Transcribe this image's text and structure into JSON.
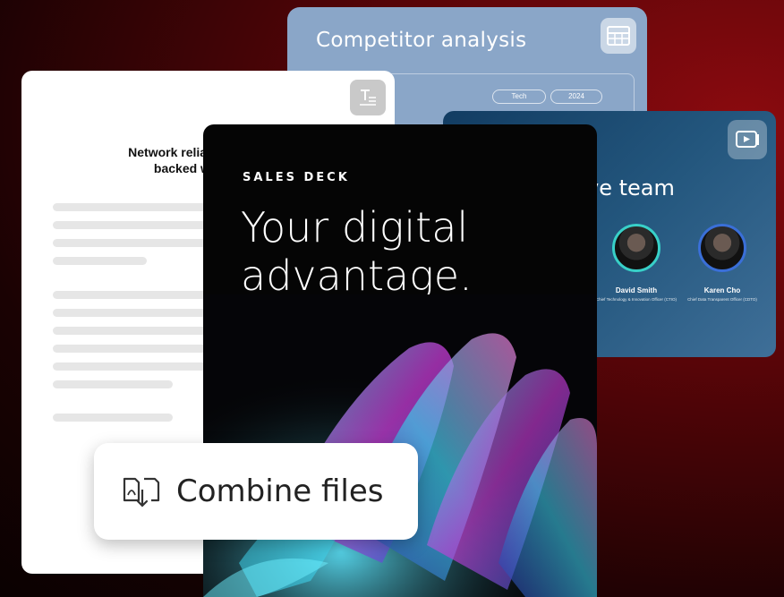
{
  "competitor_card": {
    "title": "Competitor analysis",
    "icon": "table-icon",
    "tags": [
      "Tech",
      "2024"
    ]
  },
  "team_card": {
    "heading": "ve team",
    "icon": "video-icon",
    "people": [
      {
        "name": "David Smith",
        "role": "Chief Technology & Innovation Officer (CTIO)"
      },
      {
        "name": "Karen Cho",
        "role": "Chief Data Transparent Officer (CDTO)"
      }
    ],
    "accent": "#38d0c8"
  },
  "document_card": {
    "title_line1": "Network reliability th",
    "title_line2": "backed wi-fi",
    "icon": "text-document-icon"
  },
  "sales_deck": {
    "kicker": "SALES DECK",
    "headline_line1": "Your digital",
    "headline_line2": "advantage."
  },
  "combine_chip": {
    "label": "Combine files",
    "icon": "combine-files-icon"
  }
}
